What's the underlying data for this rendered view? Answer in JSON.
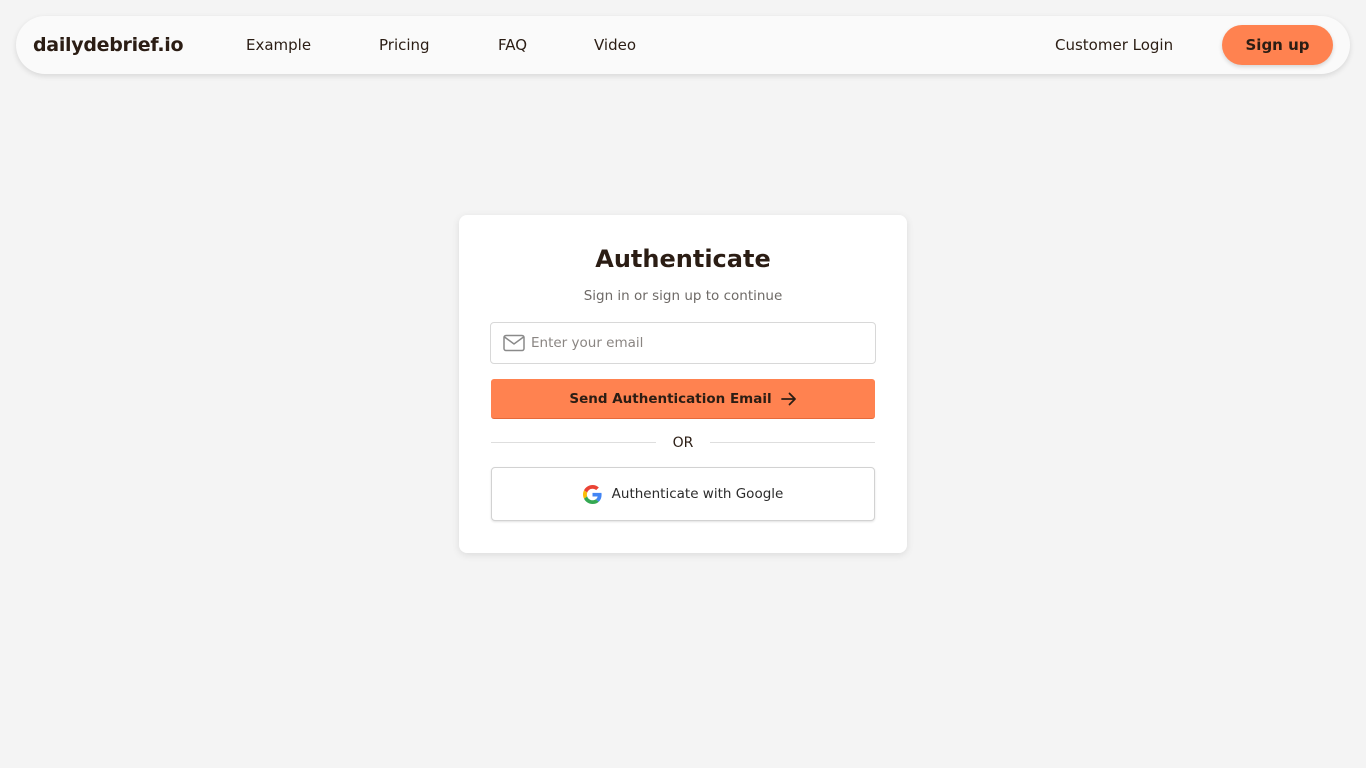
{
  "nav": {
    "brand": "dailydebrief.io",
    "links": [
      "Example",
      "Pricing",
      "FAQ",
      "Video"
    ],
    "login": "Customer Login",
    "signup": "Sign up"
  },
  "auth": {
    "title": "Authenticate",
    "subtitle": "Sign in or sign up to continue",
    "email_placeholder": "Enter your email",
    "email_value": "",
    "send_button": "Send Authentication Email",
    "divider": "OR",
    "google_button": "Authenticate with Google"
  },
  "icons": {
    "email": "mail-icon",
    "send": "arrow-right-icon",
    "google": "google-icon"
  },
  "colors": {
    "accent": "#ff8250",
    "background": "#f4f4f4",
    "text": "#2b1d14"
  }
}
